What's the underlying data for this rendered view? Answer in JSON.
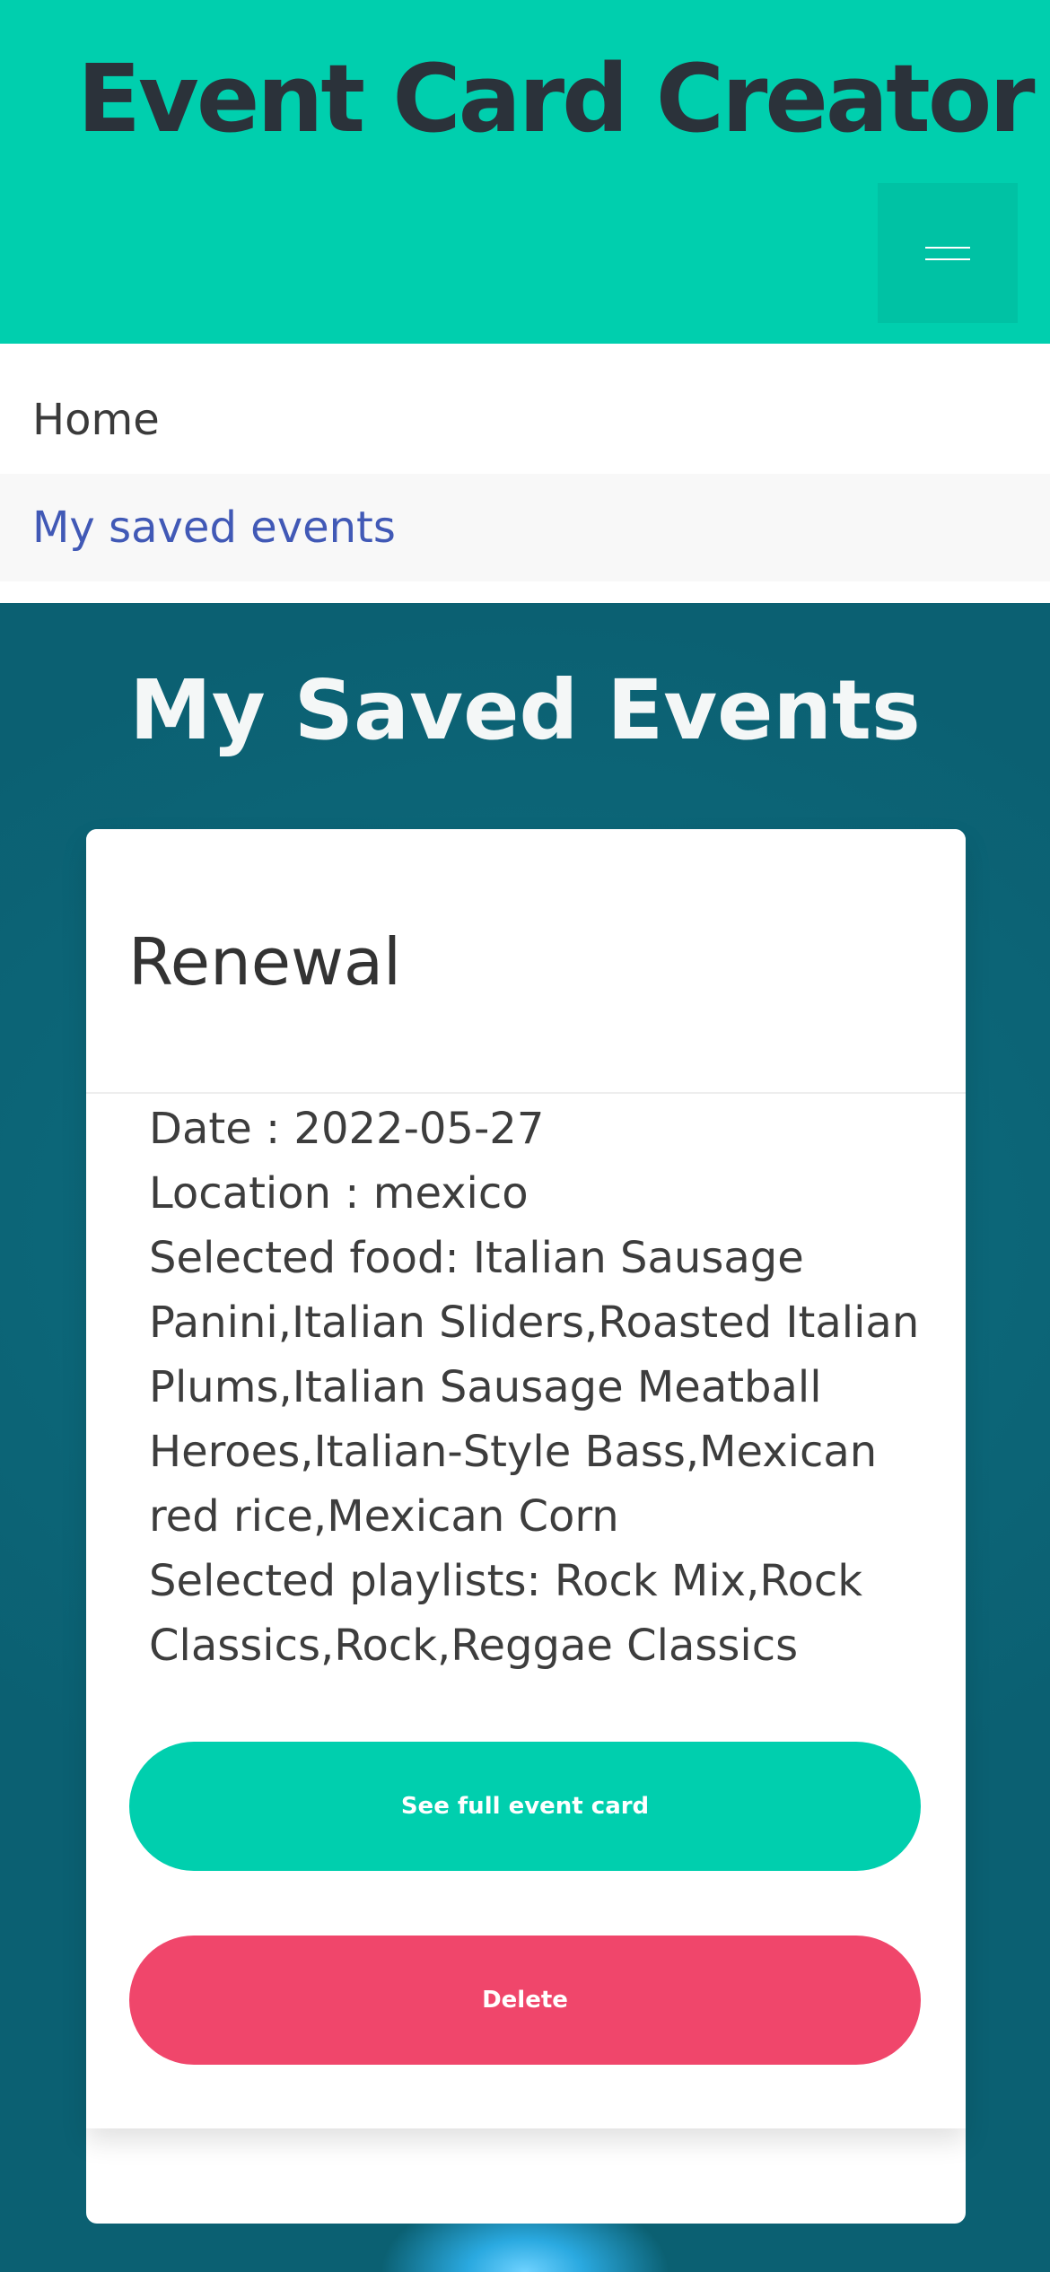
{
  "header": {
    "app_title": "Event Card Creator",
    "menu_icon": "hamburger-icon"
  },
  "nav": {
    "items": [
      {
        "label": "Home"
      },
      {
        "label": "My saved events"
      }
    ]
  },
  "main": {
    "heading": "My Saved Events",
    "events": [
      {
        "title": "Renewal",
        "date_line": "Date : 2022-05-27",
        "location_line": "Location : mexico",
        "food_line": "Selected food: Italian Sausage Panini,Italian Sliders,Roasted Italian Plums,Italian Sausage Meatball Heroes,Italian-Style Bass,Mexican red rice,Mexican Corn",
        "playlists_line": "Selected playlists: Rock Mix,Rock Classics,Rock,Reggae Classics",
        "full_card_label": "See full event card",
        "delete_label": "Delete"
      }
    ]
  },
  "colors": {
    "header_bg": "#00cfae",
    "accent_link": "#4159b6",
    "delete_button": "#f0466b",
    "page_bg": "#0d6a7c"
  }
}
